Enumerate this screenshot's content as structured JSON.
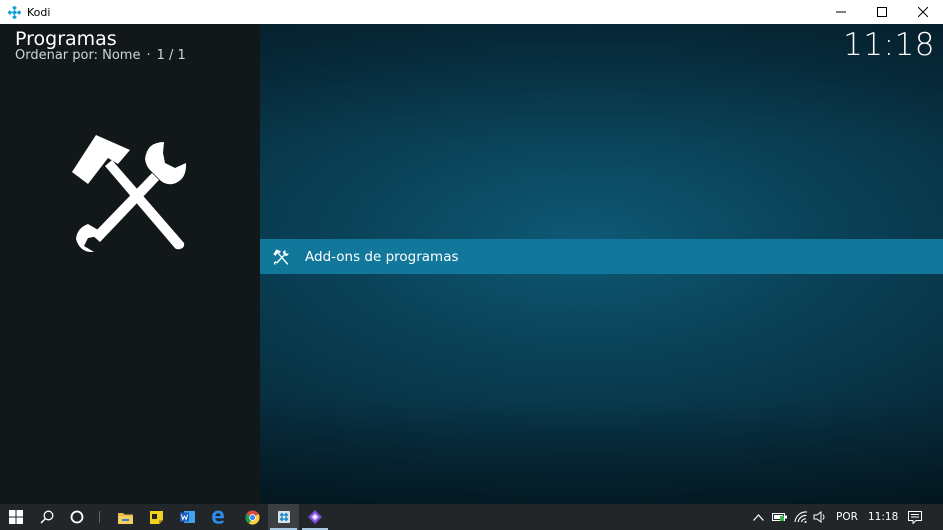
{
  "window": {
    "title": "Kodi",
    "controls": {
      "minimize": "minimize-icon",
      "maximize": "maximize-icon",
      "close": "close-icon"
    }
  },
  "kodi": {
    "header": {
      "title": "Programas",
      "sort_label": "Ordenar por: Nome",
      "separator": "·",
      "page": "1 / 1"
    },
    "clock": "11:18",
    "list": [
      {
        "label": "Add-ons de programas",
        "icon": "tools-icon",
        "selected": true
      }
    ],
    "colors": {
      "selected_item": "#12789b",
      "left_panel": "#121819",
      "background": "#0a4258"
    }
  },
  "taskbar": {
    "apps": [
      "start-icon",
      "search-icon",
      "cortana-icon",
      "task-view-icon",
      "file-explorer-icon",
      "sticky-notes-icon",
      "word-icon",
      "edge-icon",
      "chrome-icon",
      "kodi-icon",
      "app-icon"
    ],
    "tray": {
      "language": "POR",
      "time": "11:18"
    }
  }
}
